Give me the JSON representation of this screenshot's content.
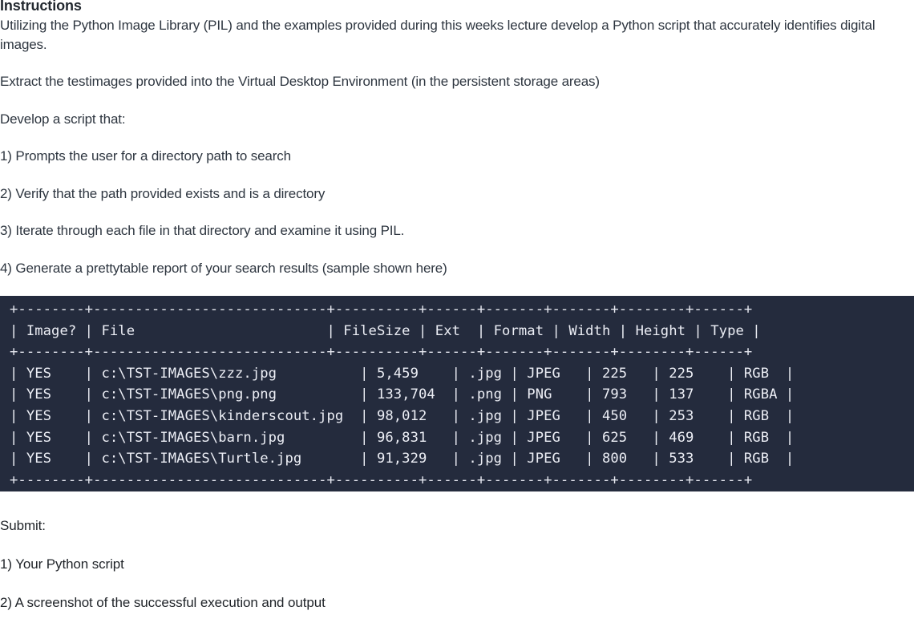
{
  "document": {
    "heading": "Instructions",
    "paragraphs": [
      "Utilizing the Python Image Library (PIL) and the examples provided during this weeks lecture develop a Python script that accurately identifies digital images.",
      "Extract the testimages provided into the Virtual Desktop Environment (in the persistent storage areas)",
      "Develop a script that:",
      "1) Prompts the user for a directory path to search",
      "2) Verify that the path provided exists and is a directory",
      "3) Iterate through each file in that directory and examine it using PIL.",
      "4) Generate a prettytable report of your search results (sample shown here)"
    ],
    "submit": {
      "label": "Submit:",
      "items": [
        "1) Your Python script",
        "2) A screenshot of the successful execution and output"
      ]
    }
  },
  "terminal": {
    "background_color": "#242b3d",
    "text_color": "#eceef5",
    "lines": [
      "+--------+----------------------------+----------+------+-------+-------+--------+------+",
      "| Image? | File                       | FileSize | Ext  | Format | Width | Height | Type |",
      "+--------+----------------------------+----------+------+-------+-------+--------+------+",
      "| YES    | c:\\TST-IMAGES\\zzz.jpg          | 5,459    | .jpg | JPEG   | 225   | 225    | RGB  |",
      "| YES    | c:\\TST-IMAGES\\png.png          | 133,704  | .png | PNG    | 793   | 137    | RGBA |",
      "| YES    | c:\\TST-IMAGES\\kinderscout.jpg  | 98,012   | .jpg | JPEG   | 450   | 253    | RGB  |",
      "| YES    | c:\\TST-IMAGES\\barn.jpg         | 96,831   | .jpg | JPEG   | 625   | 469    | RGB  |",
      "| YES    | c:\\TST-IMAGES\\Turtle.jpg       | 91,329   | .jpg | JPEG   | 800   | 533    | RGB  |",
      "+--------+----------------------------+----------+------+-------+-------+--------+------+",
      "|"
    ],
    "table": {
      "columns": [
        "Image?",
        "File",
        "FileSize",
        "Ext",
        "Format",
        "Width",
        "Height",
        "Type"
      ],
      "rows": [
        [
          "YES",
          "c:\\TST-IMAGES\\zzz.jpg",
          "5,459",
          ".jpg",
          "JPEG",
          "225",
          "225",
          "RGB"
        ],
        [
          "YES",
          "c:\\TST-IMAGES\\png.png",
          "133,704",
          ".png",
          "PNG",
          "793",
          "137",
          "RGBA"
        ],
        [
          "YES",
          "c:\\TST-IMAGES\\kinderscout.jpg",
          "98,012",
          ".jpg",
          "JPEG",
          "450",
          "253",
          "RGB"
        ],
        [
          "YES",
          "c:\\TST-IMAGES\\barn.jpg",
          "96,831",
          ".jpg",
          "JPEG",
          "625",
          "469",
          "RGB"
        ],
        [
          "YES",
          "c:\\TST-IMAGES\\Turtle.jpg",
          "91,329",
          ".jpg",
          "JPEG",
          "800",
          "533",
          "RGB"
        ]
      ]
    }
  }
}
